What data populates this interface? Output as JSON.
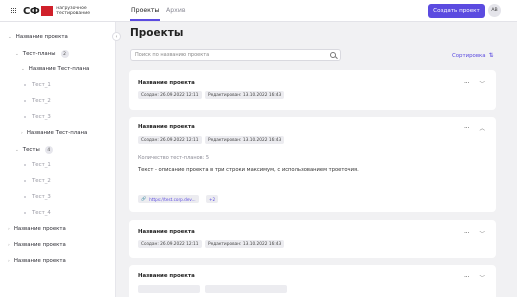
{
  "header": {
    "logo_mark": "СФ",
    "logo_text_line1": "нагрузочное",
    "logo_text_line2": "тестирование",
    "tabs": [
      {
        "label": "Проекты",
        "active": true
      },
      {
        "label": "Архив",
        "active": false
      }
    ],
    "create_button": "Создать проект",
    "avatar_initials": "AB",
    "accent_color": "#5b4be0",
    "brand_color": "#d0202a"
  },
  "sidebar": {
    "collapse_icon": "chevron-left-icon",
    "tree": [
      {
        "label": "Название проекта",
        "type": "project",
        "expanded": true
      },
      {
        "label": "Тест-планы",
        "type": "group",
        "count": "2",
        "expanded": true
      },
      {
        "label": "Название Тест-плана",
        "type": "plan",
        "expanded": true
      },
      {
        "label": "Тест_1",
        "type": "leaf"
      },
      {
        "label": "Тест_2",
        "type": "leaf"
      },
      {
        "label": "Тест_3",
        "type": "leaf"
      },
      {
        "label": "Название Тест-плана",
        "type": "plan",
        "expanded": false
      },
      {
        "label": "Тесты",
        "type": "group",
        "count": "4",
        "expanded": true
      },
      {
        "label": "Тест_1",
        "type": "leaf"
      },
      {
        "label": "Тест_2",
        "type": "leaf"
      },
      {
        "label": "Тест_3",
        "type": "leaf"
      },
      {
        "label": "Тест_4",
        "type": "leaf"
      },
      {
        "label": "Название проекта",
        "type": "project",
        "expanded": false
      },
      {
        "label": "Название проекта",
        "type": "project",
        "expanded": false
      },
      {
        "label": "Название проекта",
        "type": "project",
        "expanded": false
      }
    ]
  },
  "main": {
    "title": "Проекты",
    "search_placeholder": "Поиск по названию проекта",
    "sort_label": "Сортировка",
    "cards": [
      {
        "title": "Название проекта",
        "created": "Создан: 26.09.2022 12:11",
        "edited": "Редактирован: 13.10.2022 16:43",
        "expanded": false
      },
      {
        "title": "Название проекта",
        "created": "Создан: 26.09.2022 12:11",
        "edited": "Редактирован: 13.10.2022 16:43",
        "expanded": true,
        "plans_count": "Количество тест-планов: 5",
        "description": "Текст - описание проекта в три строки максимум, с использованием троеточия.",
        "link": "https://test.corp.dev...",
        "more_links": "+2"
      },
      {
        "title": "Название проекта",
        "created": "Создан: 26.09.2022 12:11",
        "edited": "Редактирован: 13.10.2022 16:43",
        "expanded": false
      },
      {
        "title": "Название проекта",
        "expanded": false
      }
    ]
  }
}
